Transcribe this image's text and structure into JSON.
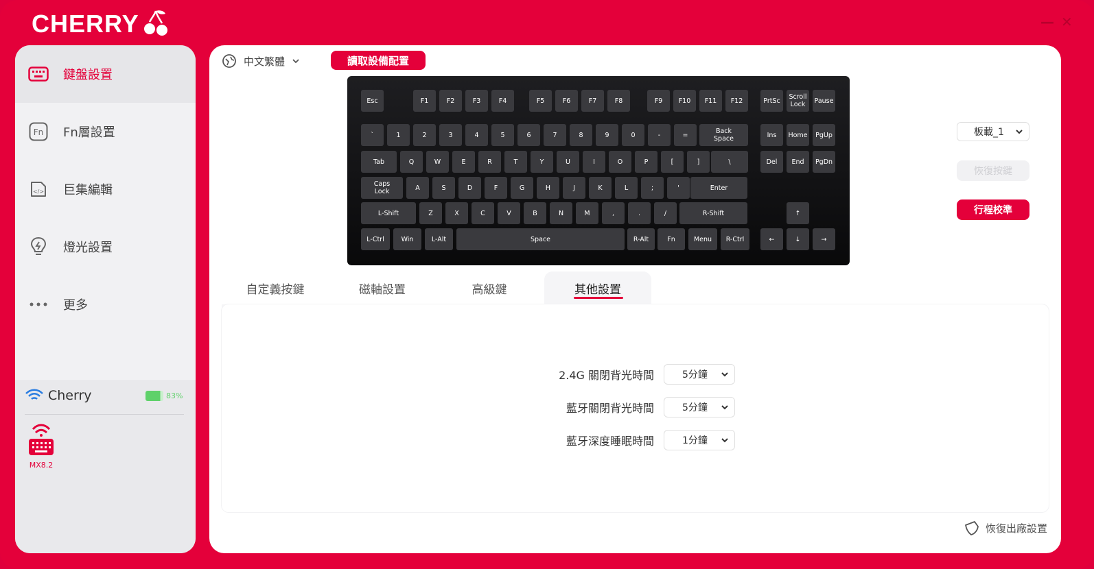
{
  "app": {
    "brand": "CHERRY",
    "minimize": "—",
    "close": "✕"
  },
  "sidebar": {
    "items": [
      {
        "label": "鍵盤設置",
        "icon": "keyboard-icon"
      },
      {
        "label": "Fn層設置",
        "icon": "fn-icon"
      },
      {
        "label": "巨集編輯",
        "icon": "macro-icon"
      },
      {
        "label": "燈光設置",
        "icon": "light-icon"
      },
      {
        "label": "更多",
        "icon": "more-icon"
      }
    ],
    "device": {
      "name": "Cherry",
      "battery": "83%",
      "battery_level": 0.83,
      "model": "MX8.2"
    }
  },
  "header": {
    "language": "中文繁體",
    "read_button": "讀取設備配置"
  },
  "keyboard": {
    "rows": [
      [
        "Esc",
        "F1",
        "F2",
        "F3",
        "F4",
        "F5",
        "F6",
        "F7",
        "F8",
        "F9",
        "F10",
        "F11",
        "F12",
        "PrtSc",
        "Scroll Lock",
        "Pause"
      ],
      [
        "`",
        "1",
        "2",
        "3",
        "4",
        "5",
        "6",
        "7",
        "8",
        "9",
        "0",
        "-",
        "=",
        "Back Space",
        "Ins",
        "Home",
        "PgUp"
      ],
      [
        "Tab",
        "Q",
        "W",
        "E",
        "R",
        "T",
        "Y",
        "U",
        "I",
        "O",
        "P",
        "[",
        "]",
        "\\",
        "Del",
        "End",
        "PgDn"
      ],
      [
        "Caps Lock",
        "A",
        "S",
        "D",
        "F",
        "G",
        "H",
        "J",
        "K",
        "L",
        ";",
        "'",
        "Enter"
      ],
      [
        "L-Shift",
        "Z",
        "X",
        "C",
        "V",
        "B",
        "N",
        "M",
        ",",
        ".",
        "/",
        "R-Shift",
        "↑"
      ],
      [
        "L-Ctrl",
        "Win",
        "L-Alt",
        "Space",
        "R-Alt",
        "Fn",
        "Menu",
        "R-Ctrl",
        "←",
        "↓",
        "→"
      ]
    ]
  },
  "right_panel": {
    "profile": "板載_1",
    "restore_key": "恢復按鍵",
    "calibrate": "行程校準"
  },
  "tabs": [
    "自定義按鍵",
    "磁軸設置",
    "高級鍵",
    "其他設置"
  ],
  "settings": [
    {
      "label": "2.4G 關閉背光時間",
      "value": "5分鐘"
    },
    {
      "label": "藍牙關閉背光時間",
      "value": "5分鐘"
    },
    {
      "label": "藍牙深度睡眠時間",
      "value": "1分鐘"
    }
  ],
  "footer": {
    "factory_reset": "恢復出廠設置"
  },
  "colors": {
    "accent": "#e4003a",
    "battery": "#5fd16a"
  }
}
